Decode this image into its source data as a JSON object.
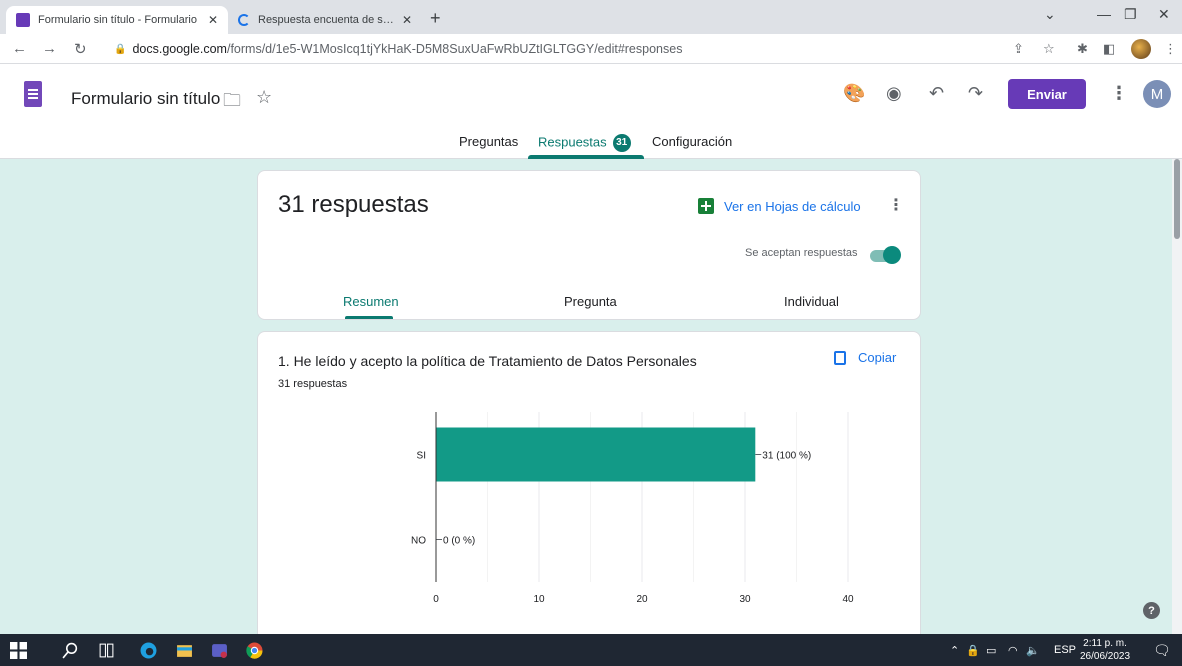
{
  "browser": {
    "tabs": [
      {
        "title": "Formulario sin título - Formulario",
        "active": true,
        "icon": "forms-favicon"
      },
      {
        "title": "Respuesta encuenta de satisfacción",
        "active": false,
        "icon": "loading-icon"
      }
    ],
    "url_host": "docs.google.com",
    "url_path": "/forms/d/1e5-W1MosIcq1tjYkHaK-D5M8SuxUaFwRbUZtIGLTGGY/edit#responses"
  },
  "header": {
    "title": "Formulario sin título",
    "send_label": "Enviar",
    "avatar_letter": "M",
    "tabs": {
      "preguntas": "Preguntas",
      "respuestas": "Respuestas",
      "config": "Configuración"
    },
    "responses_badge": "31"
  },
  "summary": {
    "count_label": "31 respuestas",
    "sheets_label": "Ver en Hojas de cálculo",
    "accepting_label": "Se aceptan respuestas",
    "accepting": true,
    "subtabs": {
      "resumen": "Resumen",
      "pregunta": "Pregunta",
      "individual": "Individual"
    }
  },
  "question": {
    "title": "1. He leído y acepto la política de Tratamiento de Datos Personales",
    "subtitle": "31 respuestas",
    "copy_label": "Copiar"
  },
  "chart_data": {
    "type": "bar",
    "orientation": "horizontal",
    "categories": [
      "SI",
      "NO"
    ],
    "values": [
      31,
      0
    ],
    "data_labels": [
      "31 (100 %)",
      "0 (0 %)"
    ],
    "xlim": [
      0,
      40
    ],
    "xticks": [
      0,
      10,
      20,
      30,
      40
    ],
    "grid": true,
    "color": "#129a87"
  },
  "taskbar": {
    "lang": "ESP",
    "time": "2:11 p. m.",
    "date": "26/06/2023"
  },
  "colors": {
    "accent": "#673ab7",
    "teal": "#0b7a70",
    "background": "#d9efec"
  }
}
